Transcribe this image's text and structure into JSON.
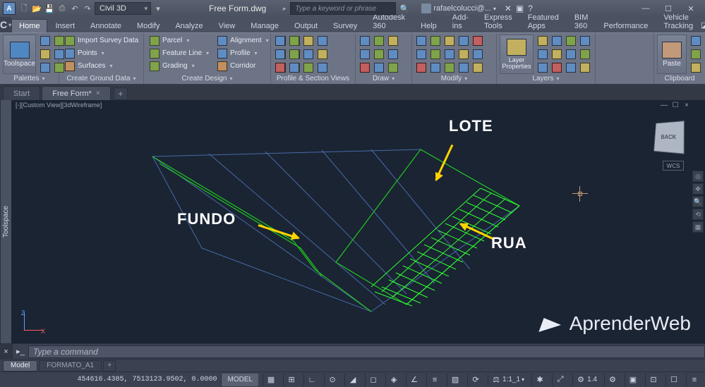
{
  "titlebar": {
    "product": "Civil 3D",
    "document": "Free Form.dwg",
    "search_placeholder": "Type a keyword or phrase",
    "user": "rafaelcolucci@..."
  },
  "ribbon_tabs": [
    "Home",
    "Insert",
    "Annotate",
    "Modify",
    "Analyze",
    "View",
    "Manage",
    "Output",
    "Survey",
    "Autodesk 360",
    "Help",
    "Add-ins",
    "Express Tools",
    "Featured Apps",
    "BIM 360",
    "Performance",
    "Vehicle Tracking"
  ],
  "ribbon_active_tab": "Home",
  "ribbon": {
    "palettes": {
      "title": "Palettes",
      "big": "Toolspace"
    },
    "ground": {
      "title": "Create Ground Data",
      "items": [
        "Import Survey Data",
        "Points",
        "Surfaces"
      ]
    },
    "design": {
      "title": "Create Design",
      "col1": [
        "Parcel",
        "Feature Line",
        "Grading"
      ],
      "col2": [
        "Alignment",
        "Profile",
        "Corridor"
      ]
    },
    "profile_views": {
      "title": "Profile & Section Views"
    },
    "draw": {
      "title": "Draw"
    },
    "modify": {
      "title": "Modify"
    },
    "layers": {
      "title": "Layers",
      "big": "Layer Properties"
    },
    "clipboard": {
      "title": "Clipboard",
      "big": "Paste"
    }
  },
  "doc_tabs": {
    "start": "Start",
    "active": "Free Form*"
  },
  "viewport": {
    "label": "[-][Custom View][3dWireframe]",
    "viewcube": "BACK",
    "wcs": "WCS",
    "ucs_z": "Z",
    "ucs_x": "X"
  },
  "annotations": {
    "lote": "LOTE",
    "fundo": "FUNDO",
    "rua": "RUA",
    "watermark": "AprenderWeb"
  },
  "command": {
    "placeholder": "Type a command"
  },
  "layout_tabs": [
    "Model",
    "FORMATO_A1"
  ],
  "status": {
    "coords": "454616.4385, 7513123.9502, 0.0000",
    "space": "MODEL",
    "scale": "1:1_1",
    "decimal": "1.4"
  }
}
